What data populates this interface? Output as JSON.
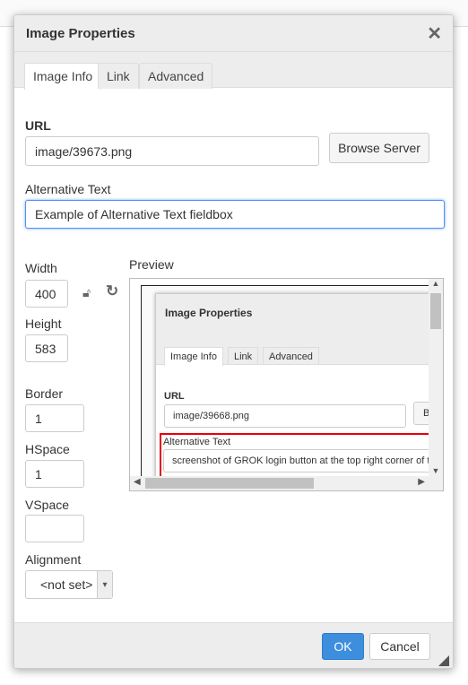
{
  "dialog": {
    "title": "Image Properties",
    "close_icon": "close-icon",
    "tabs": [
      {
        "label": "Image Info",
        "active": true
      },
      {
        "label": "Link"
      },
      {
        "label": "Advanced"
      }
    ],
    "url_label": "URL",
    "url_value": "image/39673.png",
    "browse_label": "Browse Server",
    "alt_label": "Alternative Text",
    "alt_value": "Example of Alternative Text fieldbox",
    "width_label": "Width",
    "width_value": "400",
    "height_label": "Height",
    "height_value": "583",
    "border_label": "Border",
    "border_value": "1",
    "hspace_label": "HSpace",
    "hspace_value": "1",
    "vspace_label": "VSpace",
    "vspace_value": "",
    "alignment_label": "Alignment",
    "alignment_value": "<not set>",
    "preview_label": "Preview",
    "ok_label": "OK",
    "cancel_label": "Cancel",
    "ok_color": "#3e8ede"
  },
  "preview": {
    "title": "Image Properties",
    "tabs": [
      "Image Info",
      "Link",
      "Advanced"
    ],
    "url_label": "URL",
    "url_value": "image/39668.png",
    "browse_partial": "B",
    "alt_label": "Alternative Text",
    "alt_value": "screenshot of GROK login button at the top right corner of t",
    "highlight_color": "#e8000c"
  }
}
